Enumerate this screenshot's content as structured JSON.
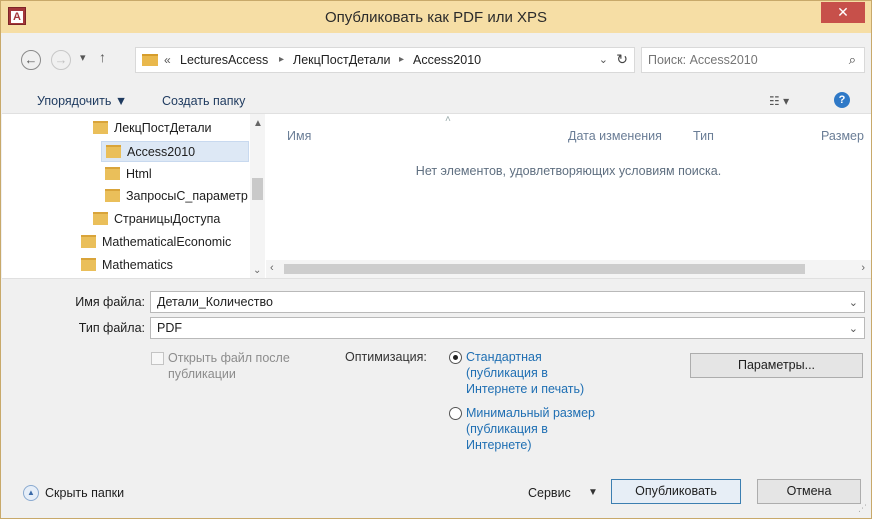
{
  "window": {
    "title": "Опубликовать как PDF или XPS",
    "app_icon": "A",
    "close": "✕"
  },
  "address": {
    "prefix": "«",
    "crumbs": [
      "LecturesAccess",
      "ЛекцПостДетали",
      "Access2010"
    ],
    "search_placeholder": "Поиск: Access2010"
  },
  "toolbar": {
    "organize": "Упорядочить ▼",
    "new_folder": "Создать папку"
  },
  "tree": {
    "items": [
      "ЛекцПостДетали",
      "Access2010",
      "Html",
      "ЗапросыС_параметр",
      "СтраницыДоступа",
      "MathematicalEconomic",
      "Mathematics"
    ],
    "selected_index": 1
  },
  "list": {
    "columns": [
      "Имя",
      "Дата изменения",
      "Тип",
      "Размер"
    ],
    "empty_message": "Нет элементов, удовлетворяющих условиям поиска."
  },
  "form": {
    "file_name_label": "Имя файла:",
    "file_name_value": "Детали_Количество",
    "file_type_label": "Тип файла:",
    "file_type_value": "PDF",
    "open_after_label": "Открыть файл после публикации",
    "optimization_label": "Оптимизация:",
    "optimization_options": [
      {
        "label": "Стандартная (публикация в Интернете и печать)",
        "selected": true
      },
      {
        "label": "Минимальный размер (публикация в Интернете)",
        "selected": false
      }
    ],
    "params_button": "Параметры..."
  },
  "footer": {
    "hide_folders": "Скрыть папки",
    "service": "Сервис",
    "publish": "Опубликовать",
    "cancel": "Отмена"
  },
  "colors": {
    "titlebar": "#f6dea5",
    "close": "#c7504a",
    "link": "#1f6fb3"
  }
}
